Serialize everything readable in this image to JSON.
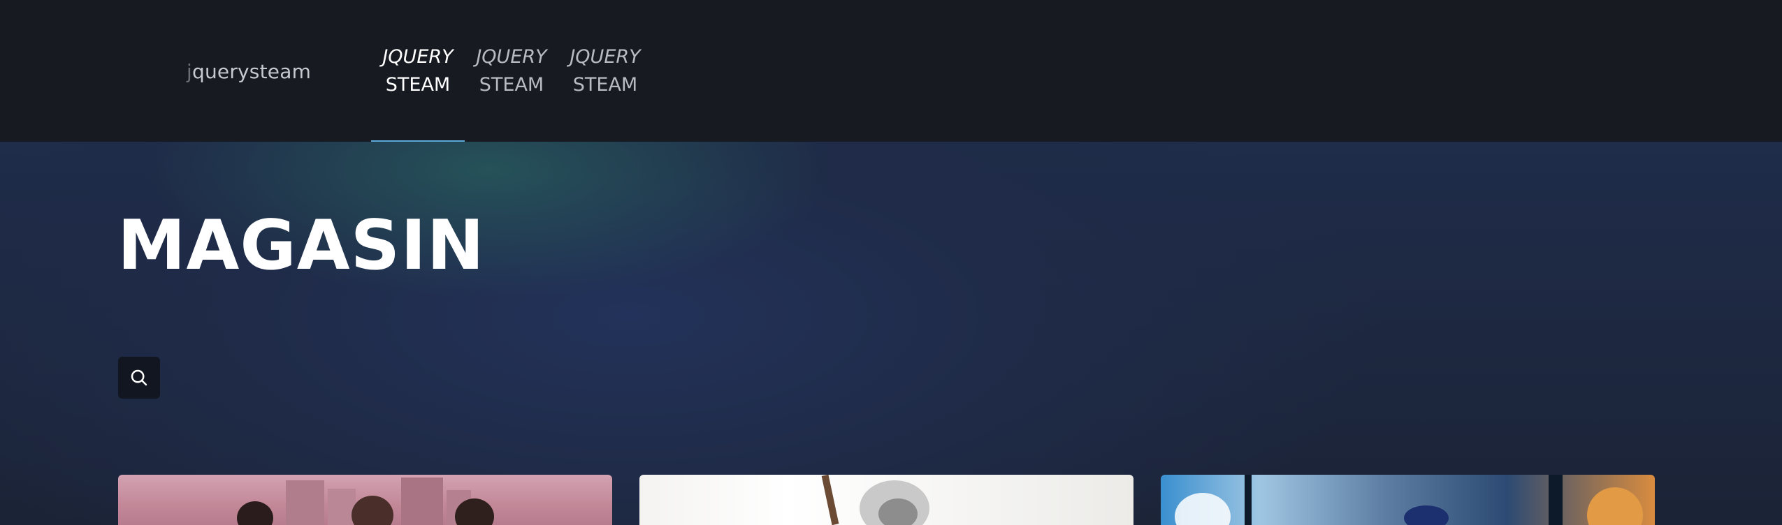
{
  "header": {
    "brand_prefix": "j",
    "brand_rest": "querysteam",
    "nav": [
      {
        "top": "JQUERY",
        "bottom": "STEAM",
        "active": true
      },
      {
        "top": "JQUERY",
        "bottom": "STEAM",
        "active": false
      },
      {
        "top": "JQUERY",
        "bottom": "STEAM",
        "active": false
      }
    ]
  },
  "main": {
    "title": "MAGASIN",
    "search_icon": "search-icon"
  },
  "cards": [
    {
      "image": "game-cover-city-characters"
    },
    {
      "image": "game-cover-white-haired-warrior"
    },
    {
      "image": "game-cover-blue-action-scene"
    }
  ],
  "colors": {
    "header_bg": "#171a21",
    "accent_underline": "#5ba9d8",
    "hero_bg": "#1f2b48"
  }
}
